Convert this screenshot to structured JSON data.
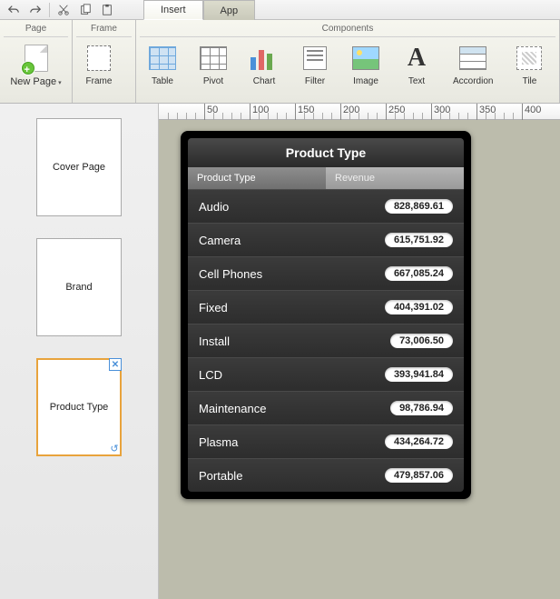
{
  "tabs": {
    "insert": "Insert",
    "app": "App"
  },
  "ribbon": {
    "page_group": "Page",
    "frame_group": "Frame",
    "components_group": "Components",
    "new_page": "New Page",
    "frame": "Frame",
    "table": "Table",
    "pivot": "Pivot",
    "chart": "Chart",
    "filter": "Filter",
    "image": "Image",
    "text": "Text",
    "accordion": "Accordion",
    "tile": "Tile"
  },
  "thumbs": {
    "cover": "Cover Page",
    "brand": "Brand",
    "ptype": "Product Type"
  },
  "ruler": [
    "50",
    "100",
    "150",
    "200",
    "250",
    "300",
    "350",
    "400"
  ],
  "widget": {
    "title": "Product Type",
    "col1": "Product Type",
    "col2": "Revenue",
    "rows": [
      {
        "name": "Audio",
        "val": "828,869.61"
      },
      {
        "name": "Camera",
        "val": "615,751.92"
      },
      {
        "name": "Cell Phones",
        "val": "667,085.24"
      },
      {
        "name": "Fixed",
        "val": "404,391.02"
      },
      {
        "name": "Install",
        "val": "73,006.50"
      },
      {
        "name": "LCD",
        "val": "393,941.84"
      },
      {
        "name": "Maintenance",
        "val": "98,786.94"
      },
      {
        "name": "Plasma",
        "val": "434,264.72"
      },
      {
        "name": "Portable",
        "val": "479,857.06"
      }
    ]
  },
  "chart_data": {
    "type": "table",
    "title": "Product Type",
    "columns": [
      "Product Type",
      "Revenue"
    ],
    "rows": [
      [
        "Audio",
        828869.61
      ],
      [
        "Camera",
        615751.92
      ],
      [
        "Cell Phones",
        667085.24
      ],
      [
        "Fixed",
        404391.02
      ],
      [
        "Install",
        73006.5
      ],
      [
        "LCD",
        393941.84
      ],
      [
        "Maintenance",
        98786.94
      ],
      [
        "Plasma",
        434264.72
      ],
      [
        "Portable",
        479857.06
      ]
    ]
  }
}
